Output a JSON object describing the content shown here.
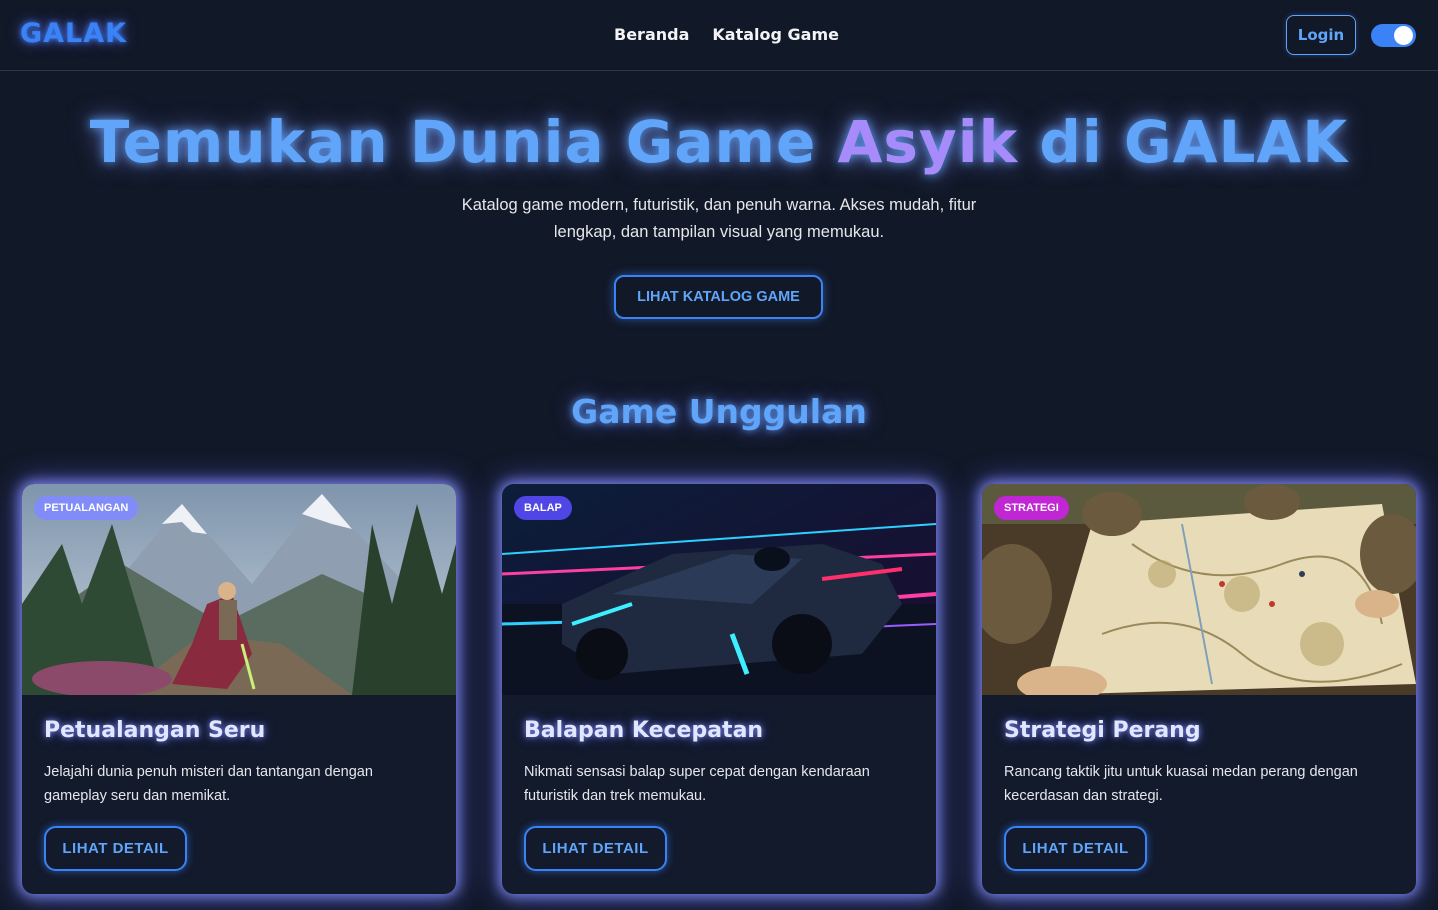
{
  "brand": {
    "logo": "GALAK"
  },
  "nav": {
    "links": [
      "Beranda",
      "Katalog Game"
    ],
    "login_label": "Login",
    "theme_toggle_on": true
  },
  "hero": {
    "title_part1": "Temukan Dunia Game ",
    "title_part2": "Asyik",
    "title_part3": " di GALAK",
    "subtitle": "Katalog game modern, futuristik, dan penuh warna. Akses mudah, fitur lengkap, dan tampilan visual yang memukau.",
    "cta_label": "LIHAT KATALOG GAME"
  },
  "featured": {
    "heading": "Game Unggulan",
    "cards": [
      {
        "badge": "PETUALANGAN",
        "title": "Petualangan Seru",
        "description": "Jelajahi dunia penuh misteri dan tantangan dengan gameplay seru dan memikat.",
        "button": "LIHAT  DETAIL",
        "image_icon": "mountain-adventure-image"
      },
      {
        "badge": "BALAP",
        "title": "Balapan Kecepatan",
        "description": "Nikmati sensasi balap super cepat dengan kendaraan futuristik dan trek memukau.",
        "button": "LIHAT  DETAIL",
        "image_icon": "race-car-image"
      },
      {
        "badge": "STRATEGI",
        "title": "Strategi Perang",
        "description": "Rancang taktik jitu untuk kuasai medan perang dengan kecerdasan dan strategi.",
        "button": "LIHAT  DETAIL",
        "image_icon": "war-map-image"
      }
    ]
  },
  "colors": {
    "background": "#111827",
    "accent_blue": "#3b82f6",
    "accent_purple": "#a78bfa",
    "badge_adventure": "#818cf8",
    "badge_racing": "#4f46e5",
    "badge_strategy": "#c026d3"
  }
}
